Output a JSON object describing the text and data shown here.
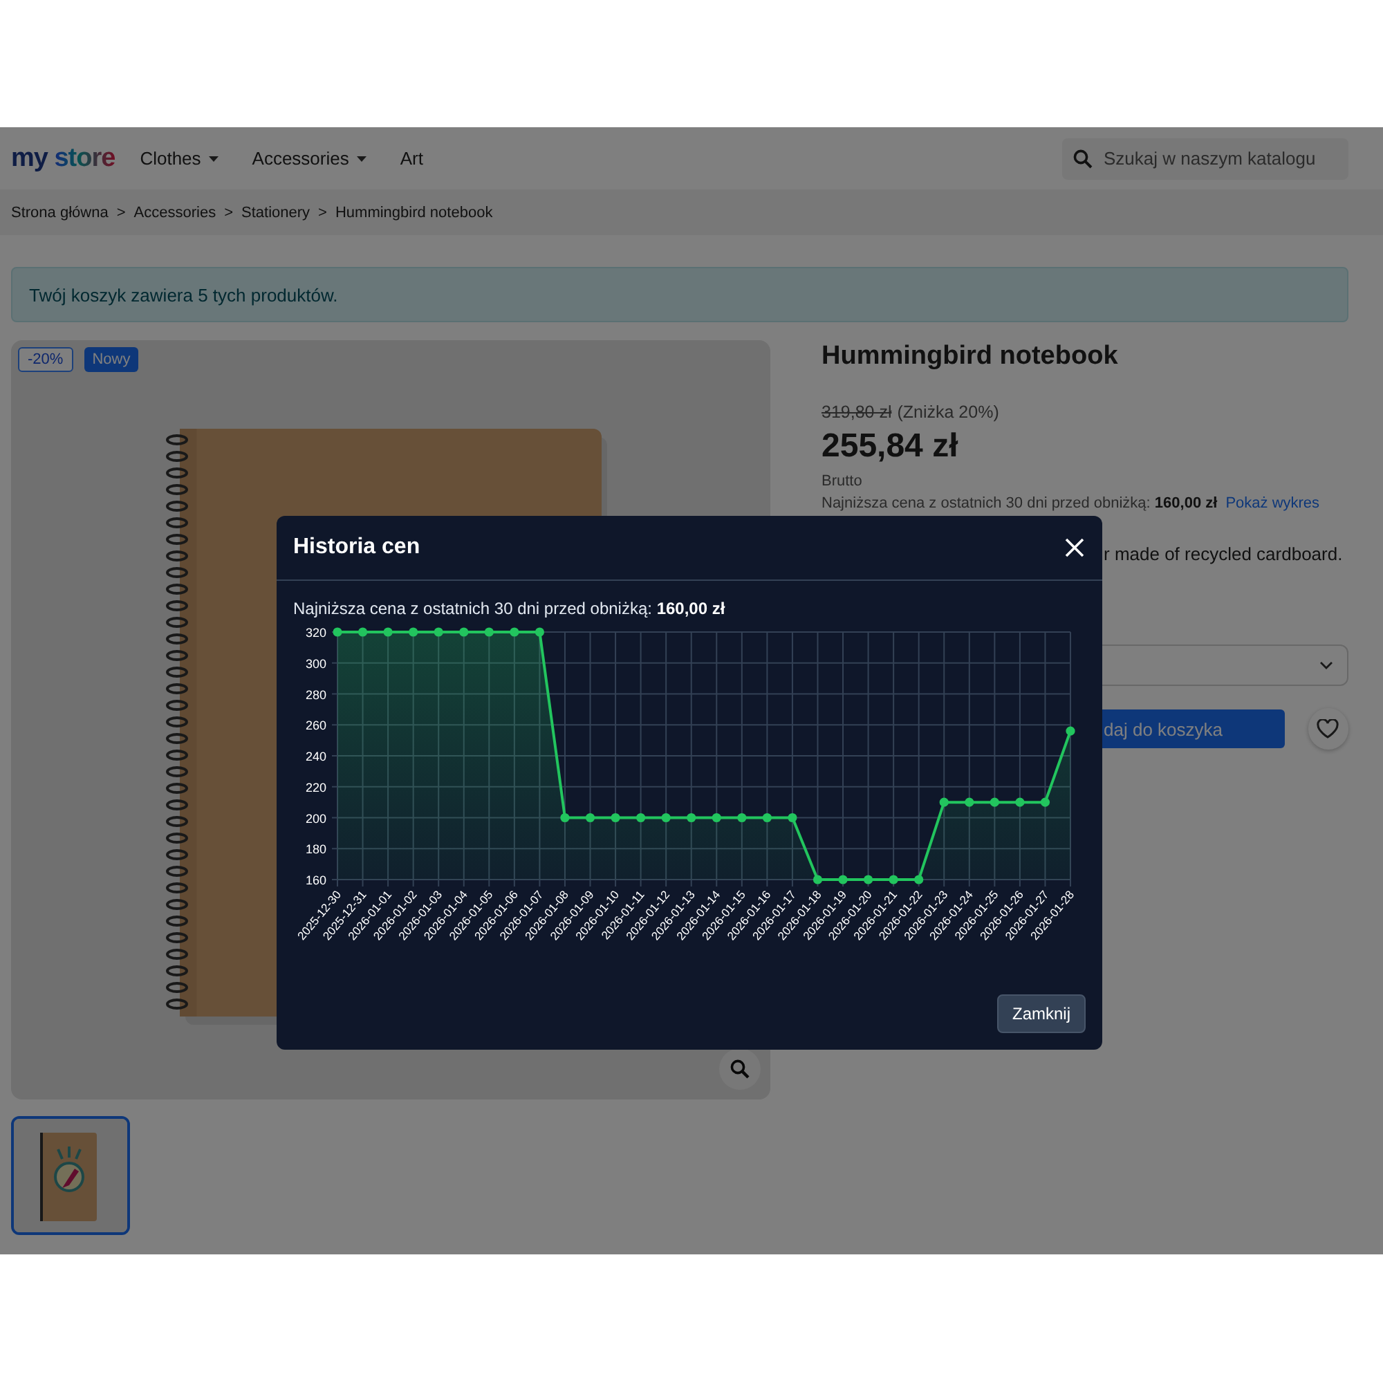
{
  "header": {
    "logo": "my store",
    "nav": [
      {
        "label": "Clothes",
        "dropdown": true
      },
      {
        "label": "Accessories",
        "dropdown": true
      },
      {
        "label": "Art",
        "dropdown": false
      }
    ],
    "search": {
      "placeholder": "Szukaj w naszym katalogu"
    }
  },
  "breadcrumb": [
    {
      "label": "Strona główna",
      "separator": ">"
    },
    {
      "label": "Accessories",
      "separator": ">"
    },
    {
      "label": "Stationery",
      "separator": ">"
    },
    {
      "label": "Hummingbird notebook"
    }
  ],
  "alert": "Twój koszyk zawiera 5 tych produktów.",
  "gallery": {
    "badges": [
      {
        "label": "-20%",
        "kind": "discount"
      },
      {
        "label": "Nowy",
        "kind": "new"
      }
    ],
    "image": {
      "kind": "picture"
    },
    "thumbnails": [
      {
        "kind": "picture",
        "selected": true
      }
    ]
  },
  "product": {
    "title": "Hummingbird notebook",
    "old_price": "319,80 zł",
    "discount": "(Zniżka 20%)",
    "price": "255,84 zł",
    "tax_label": "Brutto",
    "lowest_price": "Najniższa cena z ostatnich 30 dni przed obniżką: **160,00 zł**",
    "chart_link": "Pokaż wykres",
    "description": "r made of recycled cardboard.",
    "add_to_cart": "daj do koszyka"
  },
  "modal": {
    "title": "Historia cen",
    "lowest_price": "Najniższa cena z ostatnich 30 dni przed obniżką: **160,00 zł**",
    "close_button": "Zamknij",
    "chart_data": {
      "type": "area",
      "categories": [
        "2025-12-30",
        "2025-12-31",
        "2026-01-01",
        "2026-01-02",
        "2026-01-03",
        "2026-01-04",
        "2026-01-05",
        "2026-01-06",
        "2026-01-07",
        "2026-01-08",
        "2026-01-09",
        "2026-01-10",
        "2026-01-11",
        "2026-01-12",
        "2026-01-13",
        "2026-01-14",
        "2026-01-15",
        "2026-01-16",
        "2026-01-17",
        "2026-01-18",
        "2026-01-19",
        "2026-01-20",
        "2026-01-21",
        "2026-01-22",
        "2026-01-23",
        "2026-01-24",
        "2026-01-25",
        "2026-01-26",
        "2026-01-27",
        "2026-01-28"
      ],
      "grid": true,
      "series": [
        {
          "color": "#22c55e",
          "values": [
            320,
            320,
            320,
            320,
            320,
            320,
            320,
            320,
            320,
            200,
            200,
            200,
            200,
            200,
            200,
            200,
            200,
            200,
            200,
            160,
            160,
            160,
            160,
            160,
            210,
            210,
            210,
            210,
            210,
            256
          ]
        }
      ],
      "ylim": [
        160,
        320
      ],
      "yticks": [
        160,
        180,
        200,
        220,
        240,
        260,
        280,
        300,
        320
      ]
    }
  }
}
